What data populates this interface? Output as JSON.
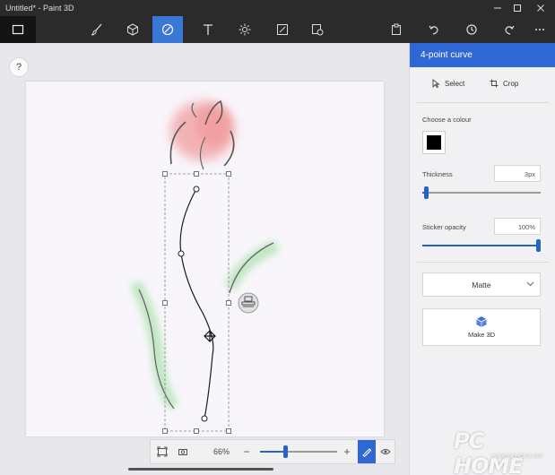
{
  "window": {
    "title": "Untitled* - Paint 3D"
  },
  "toolbar": {
    "tools": [
      "menu-icon",
      "brushes-icon",
      "3d-shapes-icon",
      "stickers-icon",
      "text-icon",
      "effects-icon",
      "canvas-icon",
      "3d-library-icon"
    ],
    "active": "stickers-icon",
    "right_tools": [
      "paste-icon",
      "undo-icon",
      "history-icon",
      "redo-icon",
      "more-icon"
    ]
  },
  "help": {
    "label": "?"
  },
  "zoom": {
    "value_label": "66%",
    "minus": "−",
    "plus": "+",
    "level": 0.32
  },
  "panel": {
    "title": "4-point curve",
    "select_label": "Select",
    "crop_label": "Crop",
    "choose_colour_label": "Choose a colour",
    "colour": "#000000",
    "thickness_label": "Thickness",
    "thickness_value": "3px",
    "thickness_level": 0.03,
    "opacity_label": "Sticker opacity",
    "opacity_value": "100%",
    "opacity_level": 1.0,
    "finish_value": "Matte",
    "make3d_label": "Make 3D"
  },
  "watermark": {
    "brand": "PC HOME",
    "site": "WWW.PCHOME.NET"
  },
  "colors": {
    "accent": "#2f67d4",
    "petal": "#e86a6a",
    "leaf": "#5cc45c"
  }
}
